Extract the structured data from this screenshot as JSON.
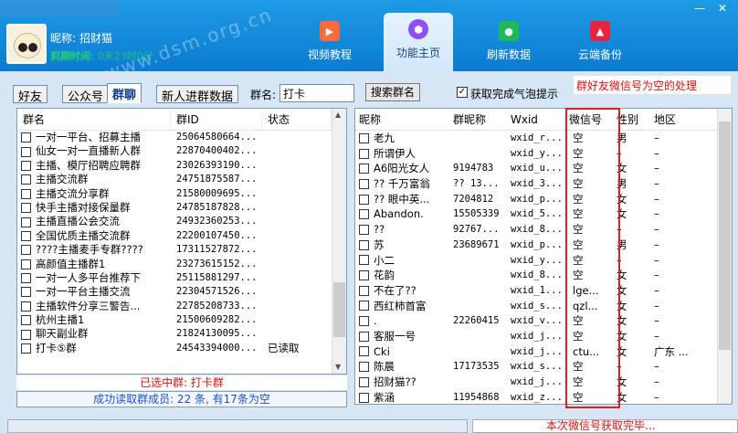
{
  "header": {
    "nickname_label": "昵称:",
    "nickname_value": "招财猫",
    "expiry_label": "到期时间:",
    "expiry_value": "0天23时0分",
    "watermark": "www.dsm.org.cn",
    "tabs": [
      {
        "label": "视频教程",
        "icon": "video-icon"
      },
      {
        "label": "功能主页",
        "icon": "home-icon",
        "active": true
      },
      {
        "label": "刷新数据",
        "icon": "refresh-icon"
      },
      {
        "label": "云端备份",
        "icon": "cloud-icon"
      }
    ]
  },
  "subtabs": [
    "好友",
    "公众号",
    "群聊",
    "新人进群数据"
  ],
  "search": {
    "label": "群名:",
    "value": "打卡",
    "button": "搜索群名"
  },
  "bubble": {
    "label": "获取完成气泡提示",
    "checked": true
  },
  "annotation_top": "群好友微信号为空的处理",
  "groups": {
    "headers": [
      "群名",
      "群ID",
      "状态"
    ],
    "rows": [
      {
        "name": "一对一平台、招募主播",
        "id": "25064580664...",
        "status": ""
      },
      {
        "name": "仙女一对一直播新人群",
        "id": "22870400402...",
        "status": ""
      },
      {
        "name": "主播、模厅招聘应聘群",
        "id": "23026393190...",
        "status": ""
      },
      {
        "name": "主播交流群",
        "id": "24751875587...",
        "status": ""
      },
      {
        "name": "主播交流分享群",
        "id": "21580009695...",
        "status": ""
      },
      {
        "name": "快手主播对接保量群",
        "id": "24785187828...",
        "status": ""
      },
      {
        "name": "主播直播公会交流",
        "id": "24932360253...",
        "status": ""
      },
      {
        "name": "全国优质主播交流群",
        "id": "22200107450...",
        "status": ""
      },
      {
        "name": "????主播麦手专群????",
        "id": "17311527872...",
        "status": ""
      },
      {
        "name": "高颜值主播群1",
        "id": "23273615152...",
        "status": ""
      },
      {
        "name": "一对一人多平台推荐下",
        "id": "25115881297...",
        "status": ""
      },
      {
        "name": "一对一平台主播交流",
        "id": "22304571526...",
        "status": ""
      },
      {
        "name": "主播软件分享三警告...",
        "id": "22785208733...",
        "status": ""
      },
      {
        "name": "杭州主播1",
        "id": "21500609282...",
        "status": ""
      },
      {
        "name": "聊天副业群",
        "id": "21824130095...",
        "status": ""
      },
      {
        "name": "打卡⑤群",
        "id": "24543394000...",
        "status": "已读取"
      }
    ],
    "selected_text": "已选中群: 打卡群",
    "success_text": "成功读取群成员: 22 条, 有17条为空"
  },
  "members": {
    "headers": [
      "昵称",
      "群昵称",
      "Wxid",
      "微信号",
      "性别",
      "地区"
    ],
    "rows": [
      {
        "nick": "老九",
        "gnick": "",
        "wxid": "wxid_r...",
        "wxno": "空",
        "sex": "男",
        "region": "–"
      },
      {
        "nick": "所谓伊人",
        "gnick": "",
        "wxid": "wxid_y...",
        "wxno": "空",
        "sex": "–",
        "region": "–"
      },
      {
        "nick": "A6阳光女人",
        "gnick": "9194783",
        "wxid": "wxid_u...",
        "wxno": "空",
        "sex": "女",
        "region": "–"
      },
      {
        "nick": "?? 千万富翁",
        "gnick": "?? 13...",
        "wxid": "wxid_3...",
        "wxno": "空",
        "sex": "男",
        "region": "–"
      },
      {
        "nick": "?? 眼中英...",
        "gnick": "7204812",
        "wxid": "wxid_p...",
        "wxno": "空",
        "sex": "女",
        "region": "–"
      },
      {
        "nick": "Abandon.",
        "gnick": "15505339",
        "wxid": "wxid_5...",
        "wxno": "空",
        "sex": "女",
        "region": "–"
      },
      {
        "nick": "??",
        "gnick": "92767...",
        "wxid": "wxid_8...",
        "wxno": "空",
        "sex": "–",
        "region": "–"
      },
      {
        "nick": "苏",
        "gnick": "23689671",
        "wxid": "wxid_p...",
        "wxno": "空",
        "sex": "男",
        "region": "–"
      },
      {
        "nick": "小二",
        "gnick": "",
        "wxid": "wxid_y...",
        "wxno": "空",
        "sex": "–",
        "region": "–"
      },
      {
        "nick": "花韵",
        "gnick": "",
        "wxid": "wxid_8...",
        "wxno": "空",
        "sex": "女",
        "region": "–"
      },
      {
        "nick": "不在了??",
        "gnick": "",
        "wxid": "wxid_1...",
        "wxno": "lge...",
        "sex": "女",
        "region": "–"
      },
      {
        "nick": "西红柿首富",
        "gnick": "",
        "wxid": "wxid_s...",
        "wxno": "qzl...",
        "sex": "女",
        "region": "–"
      },
      {
        "nick": ".",
        "gnick": "22260415",
        "wxid": "wxid_v...",
        "wxno": "空",
        "sex": "女",
        "region": "–"
      },
      {
        "nick": "客服一号",
        "gnick": "",
        "wxid": "wxid_j...",
        "wxno": "空",
        "sex": "女",
        "region": "–"
      },
      {
        "nick": "Cki",
        "gnick": "",
        "wxid": "wxid_j...",
        "wxno": "ctu...",
        "sex": "女",
        "region": "广东 ..."
      },
      {
        "nick": "陈晨",
        "gnick": "17173535",
        "wxid": "wxid_s...",
        "wxno": "空",
        "sex": "–",
        "region": "–"
      },
      {
        "nick": "招财猫??",
        "gnick": "",
        "wxid": "wxid_j...",
        "wxno": "空",
        "sex": "女",
        "region": "–"
      },
      {
        "nick": "紫涵",
        "gnick": "11954868",
        "wxid": "wxid_z...",
        "wxno": "空",
        "sex": "女",
        "region": "–"
      }
    ]
  },
  "status_bottom": "本次微信号获取完毕...",
  "colors": {
    "header_blue": "#0b7bd0",
    "panel": "#d7e6f4",
    "red": "#e01010"
  }
}
